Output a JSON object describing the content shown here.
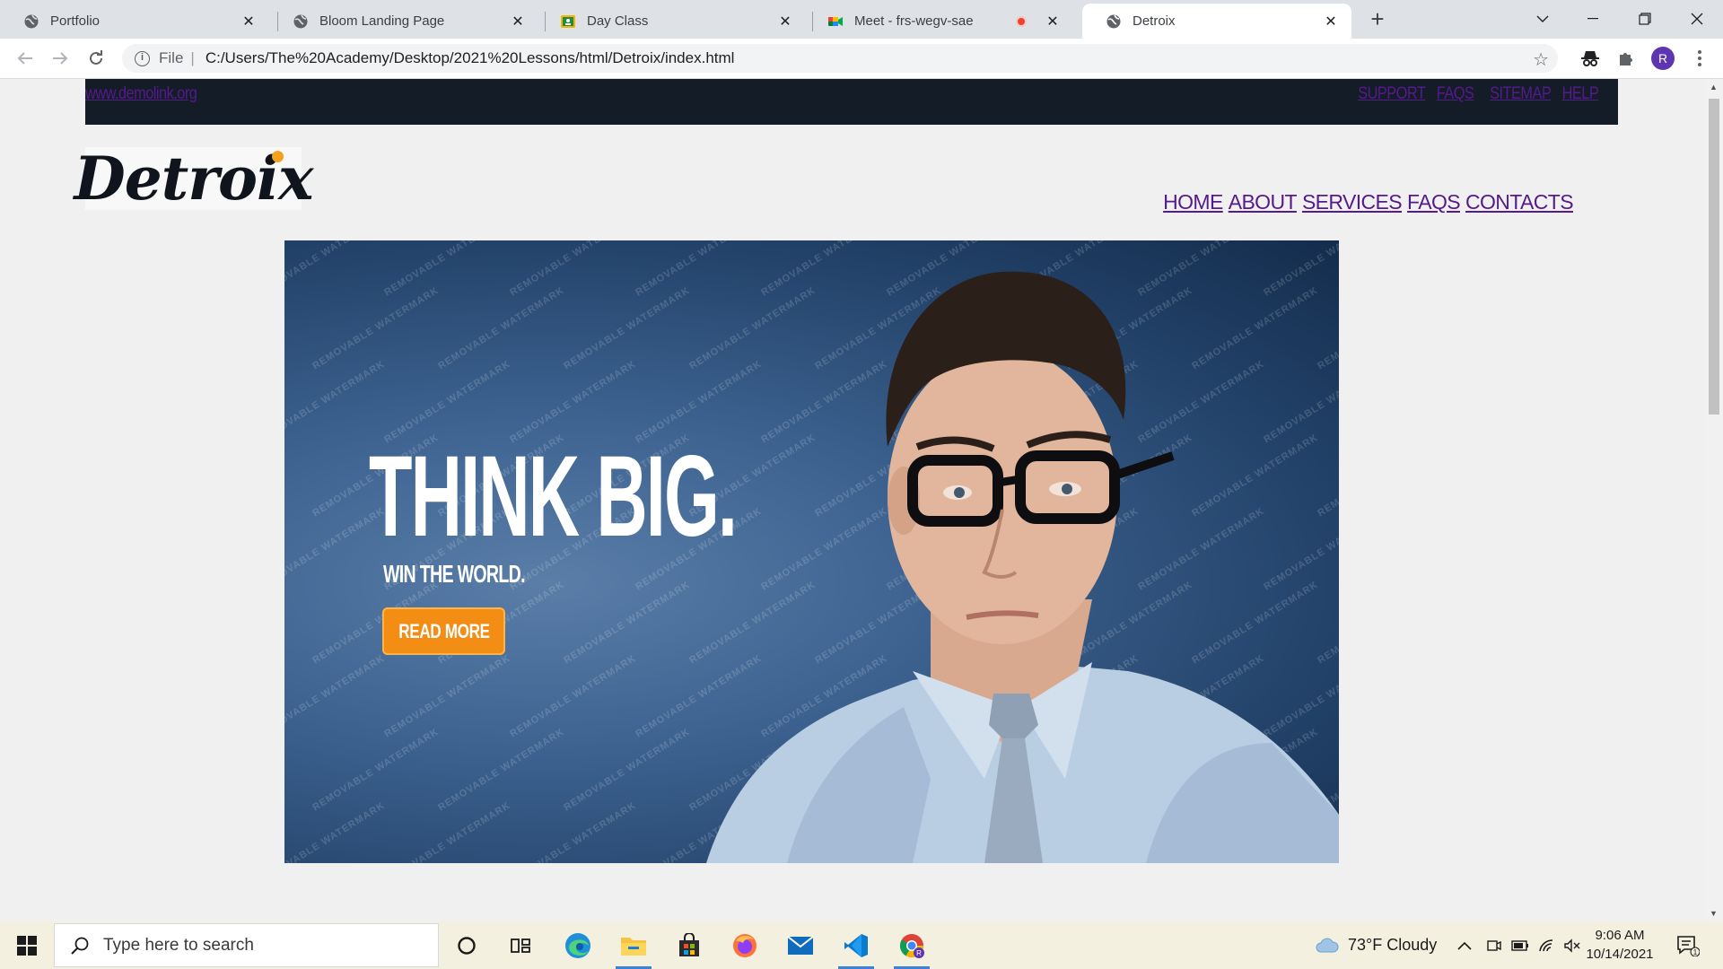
{
  "browser": {
    "tabs": [
      {
        "title": "Portfolio",
        "icon": "globe-icon",
        "active": false
      },
      {
        "title": "Bloom Landing Page",
        "icon": "globe-icon",
        "active": false
      },
      {
        "title": "Day Class",
        "icon": "google-classroom-icon",
        "active": false
      },
      {
        "title": "Meet - frs-wegv-sae",
        "icon": "google-meet-icon",
        "active": false,
        "recording": true
      },
      {
        "title": "Detroix",
        "icon": "globe-icon",
        "active": true
      }
    ],
    "new_tab_label": "+",
    "address": {
      "scheme_label": "File",
      "url": "C:/Users/The%20Academy/Desktop/2021%20Lessons/html/Detroix/index.html"
    },
    "profile_initial": "R"
  },
  "page": {
    "topbar": {
      "site_link": "www.demolink.org",
      "links": [
        "SUPPORT",
        "FAQS",
        "SITEMAP",
        "HELP"
      ]
    },
    "logo_text": "Detroix",
    "nav": [
      "HOME",
      "ABOUT",
      "SERVICES",
      "FAQS",
      "CONTACTS"
    ],
    "hero": {
      "headline": "THINK BIG.",
      "subline": "WIN THE WORLD.",
      "button": "READ MORE",
      "watermark": "REMOVABLE WATERMARK"
    }
  },
  "taskbar": {
    "search_placeholder": "Type here to search",
    "pinned": [
      "cortana-icon",
      "task-view-icon",
      "edge-icon",
      "file-explorer-icon",
      "store-icon",
      "firefox-icon",
      "mail-icon",
      "vscode-icon",
      "chrome-icon"
    ],
    "weather": "73°F  Cloudy",
    "time": "9:06 AM",
    "date": "10/14/2021",
    "notification_count": "1"
  },
  "colors": {
    "topbar_bg": "#141c28",
    "link_visited": "#551a8b",
    "hero_button": "#f48d14",
    "page_bg": "#f0f0f0"
  }
}
